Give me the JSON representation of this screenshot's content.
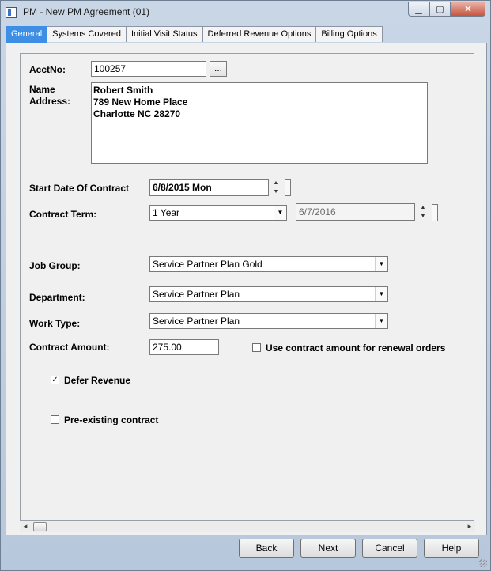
{
  "window": {
    "title": "PM - New PM Agreement (01)",
    "minimize": "▁",
    "maximize": "▢",
    "close": "✕"
  },
  "tabs": [
    {
      "label": "General",
      "active": true
    },
    {
      "label": "Systems Covered"
    },
    {
      "label": "Initial Visit Status"
    },
    {
      "label": "Deferred Revenue Options"
    },
    {
      "label": "Billing Options"
    }
  ],
  "form": {
    "acct_label": "AcctNo:",
    "acct_value": "100257",
    "acct_lookup": "...",
    "name_label": "Name",
    "address_label": "Address:",
    "address_lines": [
      "Robert  Smith",
      "789 New Home Place",
      "Charlotte NC 28270"
    ],
    "start_date_label": "Start Date Of Contract",
    "start_date_value": "6/8/2015 Mon",
    "contract_term_label": "Contract Term:",
    "contract_term_value": "1 Year",
    "end_date_value": "6/7/2016",
    "job_group_label": "Job Group:",
    "job_group_value": "Service Partner Plan Gold",
    "department_label": "Department:",
    "department_value": "Service Partner Plan",
    "work_type_label": "Work Type:",
    "work_type_value": "Service Partner Plan",
    "contract_amount_label": "Contract Amount:",
    "contract_amount_value": "275.00",
    "use_amount_label": "Use contract amount for renewal orders",
    "use_amount_checked": false,
    "defer_revenue_label": "Defer Revenue",
    "defer_revenue_checked": true,
    "preexisting_label": "Pre-existing contract",
    "preexisting_checked": false
  },
  "buttons": {
    "back": "Back",
    "next": "Next",
    "cancel": "Cancel",
    "help": "Help"
  },
  "colors": {
    "active_tab": "#3f8ee5",
    "panel": "#f0f0f0"
  }
}
